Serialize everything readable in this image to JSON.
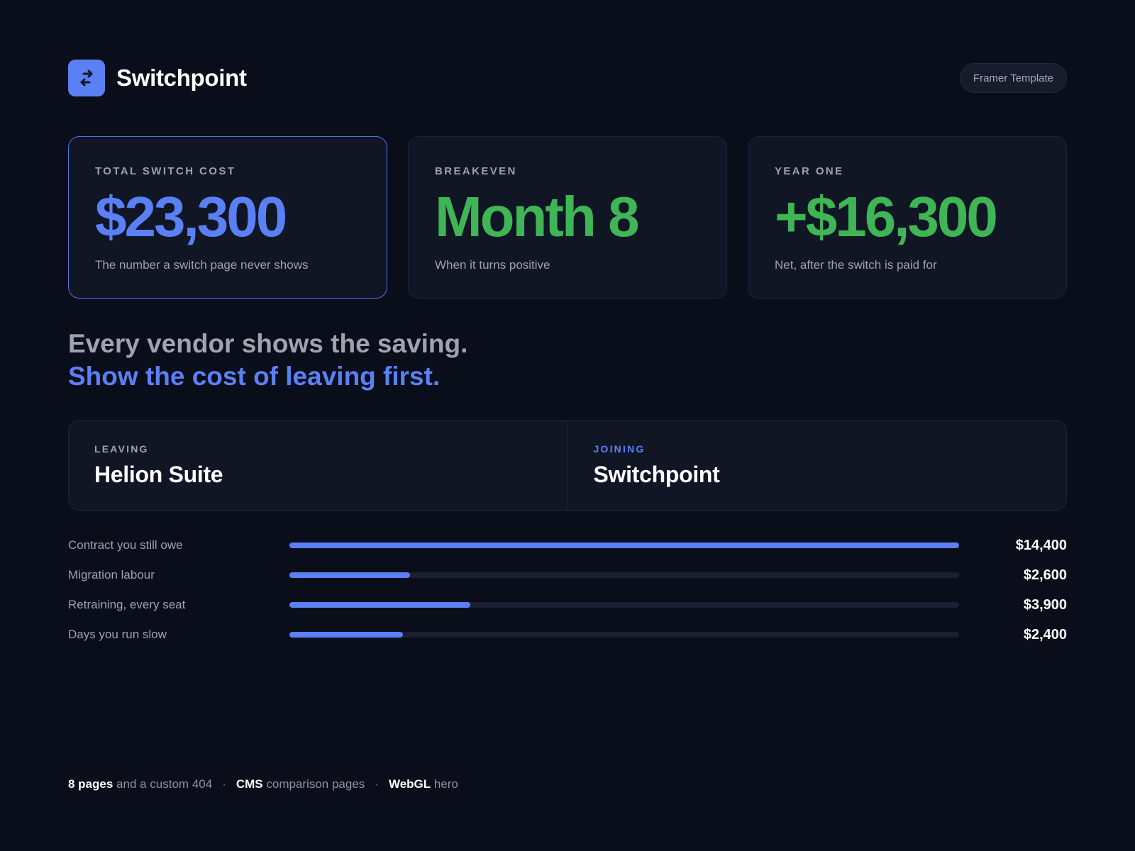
{
  "header": {
    "brand_name": "Switchpoint",
    "logo_icon": "switch-arrows-icon",
    "badge": "Framer Template"
  },
  "stats": [
    {
      "label": "TOTAL SWITCH COST",
      "value": "$23,300",
      "sub": "The number a switch page never shows",
      "color": "#5b80f6"
    },
    {
      "label": "BREAKEVEN",
      "value": "Month 8",
      "sub": "When it turns positive",
      "color": "#3fb556"
    },
    {
      "label": "YEAR ONE",
      "value": "+$16,300",
      "sub": "Net, after the switch is paid for",
      "color": "#3fb556"
    }
  ],
  "headline": {
    "line1": "Every vendor shows the saving.",
    "line2": "Show the cost of leaving first."
  },
  "compare": {
    "leaving_label": "LEAVING",
    "leaving_name": "Helion Suite",
    "joining_label": "JOINING",
    "joining_name": "Switchpoint"
  },
  "costs": [
    {
      "label": "Contract you still owe",
      "value": "$14,400",
      "fraction": 1.0
    },
    {
      "label": "Migration labour",
      "value": "$2,600",
      "fraction": 0.18
    },
    {
      "label": "Retraining, every seat",
      "value": "$3,900",
      "fraction": 0.27
    },
    {
      "label": "Days you run slow",
      "value": "$2,400",
      "fraction": 0.17
    }
  ],
  "footer": {
    "item1_bold": "8 pages",
    "item1_rest": " and a custom 404",
    "item2_bold": "CMS",
    "item2_rest": " comparison pages",
    "item3_bold": "WebGL",
    "item3_rest": " hero",
    "separator": "·"
  },
  "colors": {
    "background": "#0a0e1a",
    "accent_blue": "#5b80f6",
    "accent_green": "#3fb556"
  }
}
